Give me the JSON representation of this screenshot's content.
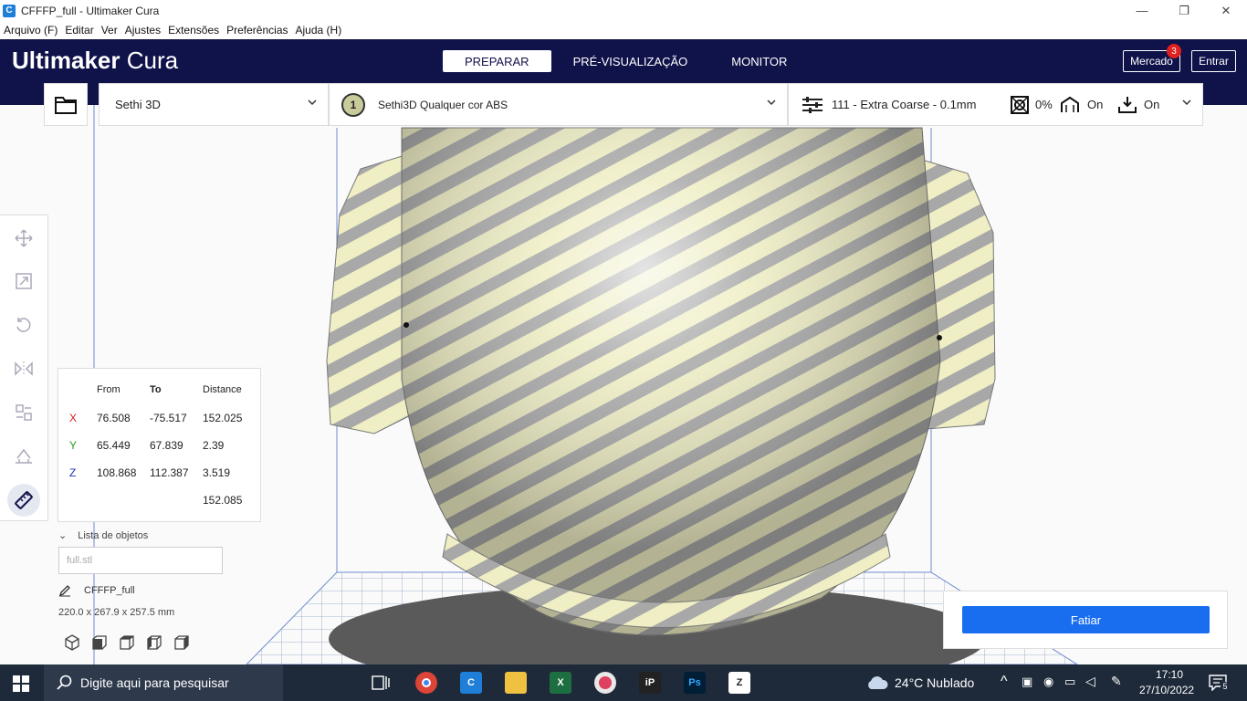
{
  "window": {
    "title": "CFFFP_full - Ultimaker Cura",
    "minimize": "—",
    "restore": "❐",
    "close": "✕"
  },
  "menu": [
    "Arquivo (F)",
    "Editar",
    "Ver",
    "Ajustes",
    "Extensões",
    "Preferências",
    "Ajuda (H)"
  ],
  "header": {
    "brand_bold": "Ultimaker",
    "brand_light": " Cura",
    "stages": [
      "PREPARAR",
      "PRÉ-VISUALIZAÇÃO",
      "MONITOR"
    ],
    "active_stage": "PREPARAR",
    "marketplace": "Mercado",
    "marketplace_badge": "3",
    "signin": "Entrar"
  },
  "toolbar": {
    "printer": "Sethi 3D",
    "extruder_number": "1",
    "material": "Sethi3D Qualquer cor ABS",
    "profile": "111 - Extra Coarse - 0.1mm",
    "infill": "0%",
    "support": "On",
    "adhesion": "On"
  },
  "measure": {
    "headers": [
      "From",
      "To",
      "Distance"
    ],
    "rows": [
      {
        "axis": "X",
        "from": "76.508",
        "to": "-75.517",
        "distance": "152.025",
        "color": "#d02020"
      },
      {
        "axis": "Y",
        "from": "65.449",
        "to": "67.839",
        "distance": "2.39",
        "color": "#20a020"
      },
      {
        "axis": "Z",
        "from": "108.868",
        "to": "112.387",
        "distance": "3.519",
        "color": "#2030b0"
      }
    ],
    "total": "152.085"
  },
  "objects": {
    "heading": "Lista de objetos",
    "filter_placeholder": "full.stl",
    "job_name": "CFFFP_full",
    "dimensions": "220.0 x 267.9 x 257.5 mm"
  },
  "slice": {
    "label": "Fatiar"
  },
  "taskbar": {
    "search_placeholder": "Digite aqui para pesquisar",
    "weather": "24°C  Nublado",
    "time": "17:10",
    "date": "27/10/2022",
    "notifications": "5"
  },
  "colors": {
    "header_bg": "#10124a",
    "accent": "#196ef0",
    "model_stripe_light": "#efeec4",
    "model_stripe_dark": "#a8a8a8"
  }
}
